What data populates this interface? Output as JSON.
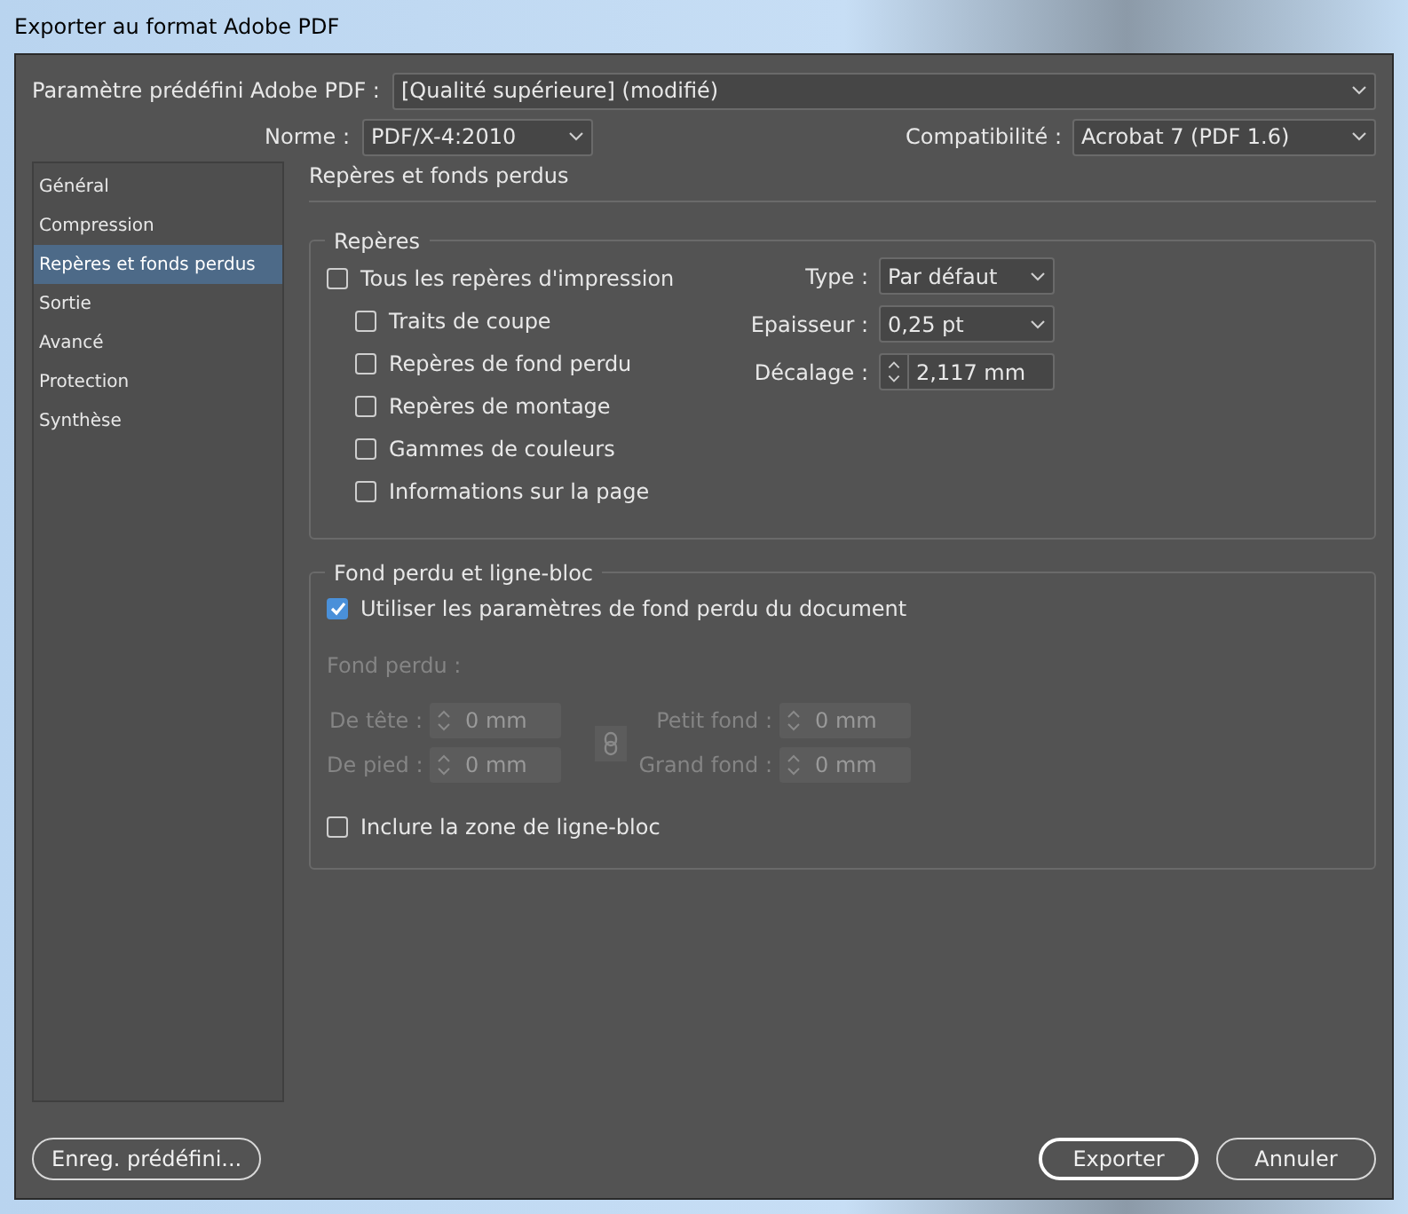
{
  "window": {
    "title": "Exporter au format Adobe PDF"
  },
  "preset": {
    "label": "Paramètre prédéfini Adobe PDF :",
    "value": "[Qualité supérieure] (modifié)"
  },
  "standard": {
    "label": "Norme  :",
    "value": "PDF/X-4:2010"
  },
  "compatibility": {
    "label": "Compatibilité :",
    "value": "Acrobat 7 (PDF 1.6)"
  },
  "sidebar": {
    "items": [
      {
        "label": "Général",
        "selected": false
      },
      {
        "label": "Compression",
        "selected": false
      },
      {
        "label": "Repères et fonds perdus",
        "selected": true
      },
      {
        "label": "Sortie",
        "selected": false
      },
      {
        "label": "Avancé",
        "selected": false
      },
      {
        "label": "Protection",
        "selected": false
      },
      {
        "label": "Synthèse",
        "selected": false
      }
    ]
  },
  "section_title": "Repères et fonds perdus",
  "marks": {
    "title": "Repères",
    "all": {
      "label": "Tous les repères d'impression",
      "checked": false
    },
    "items": [
      {
        "label": "Traits de coupe",
        "checked": false
      },
      {
        "label": "Repères de fond perdu",
        "checked": false
      },
      {
        "label": "Repères de montage",
        "checked": false
      },
      {
        "label": "Gammes de couleurs",
        "checked": false
      },
      {
        "label": "Informations sur la page",
        "checked": false
      }
    ],
    "fields": [
      {
        "kind": "dropdown",
        "label": "Type :",
        "value": "Par défaut"
      },
      {
        "kind": "dropdown",
        "label": "Epaisseur :",
        "value": "0,25 pt"
      },
      {
        "kind": "spinner",
        "label": "Décalage :",
        "value": "2,117 mm"
      }
    ]
  },
  "bleed": {
    "title": "Fond perdu et ligne-bloc",
    "use_document": {
      "label": "Utiliser les paramètres de fond perdu du document",
      "checked": true
    },
    "subtitle": "Fond perdu :",
    "fields": [
      {
        "label": "De tête :",
        "value": "0 mm",
        "disabled": true
      },
      {
        "label": "Petit fond :",
        "value": "0 mm",
        "disabled": true
      },
      {
        "label": "De pied :",
        "value": "0 mm",
        "disabled": true
      },
      {
        "label": "Grand fond :",
        "value": "0 mm",
        "disabled": true
      }
    ],
    "slug": {
      "label": "Inclure la zone de ligne-bloc",
      "checked": false
    }
  },
  "buttons": [
    {
      "label": "Enreg. prédéfini...",
      "kind": "secondary"
    },
    {
      "label": "Exporter",
      "kind": "default"
    },
    {
      "label": "Annuler",
      "kind": "secondary"
    }
  ]
}
